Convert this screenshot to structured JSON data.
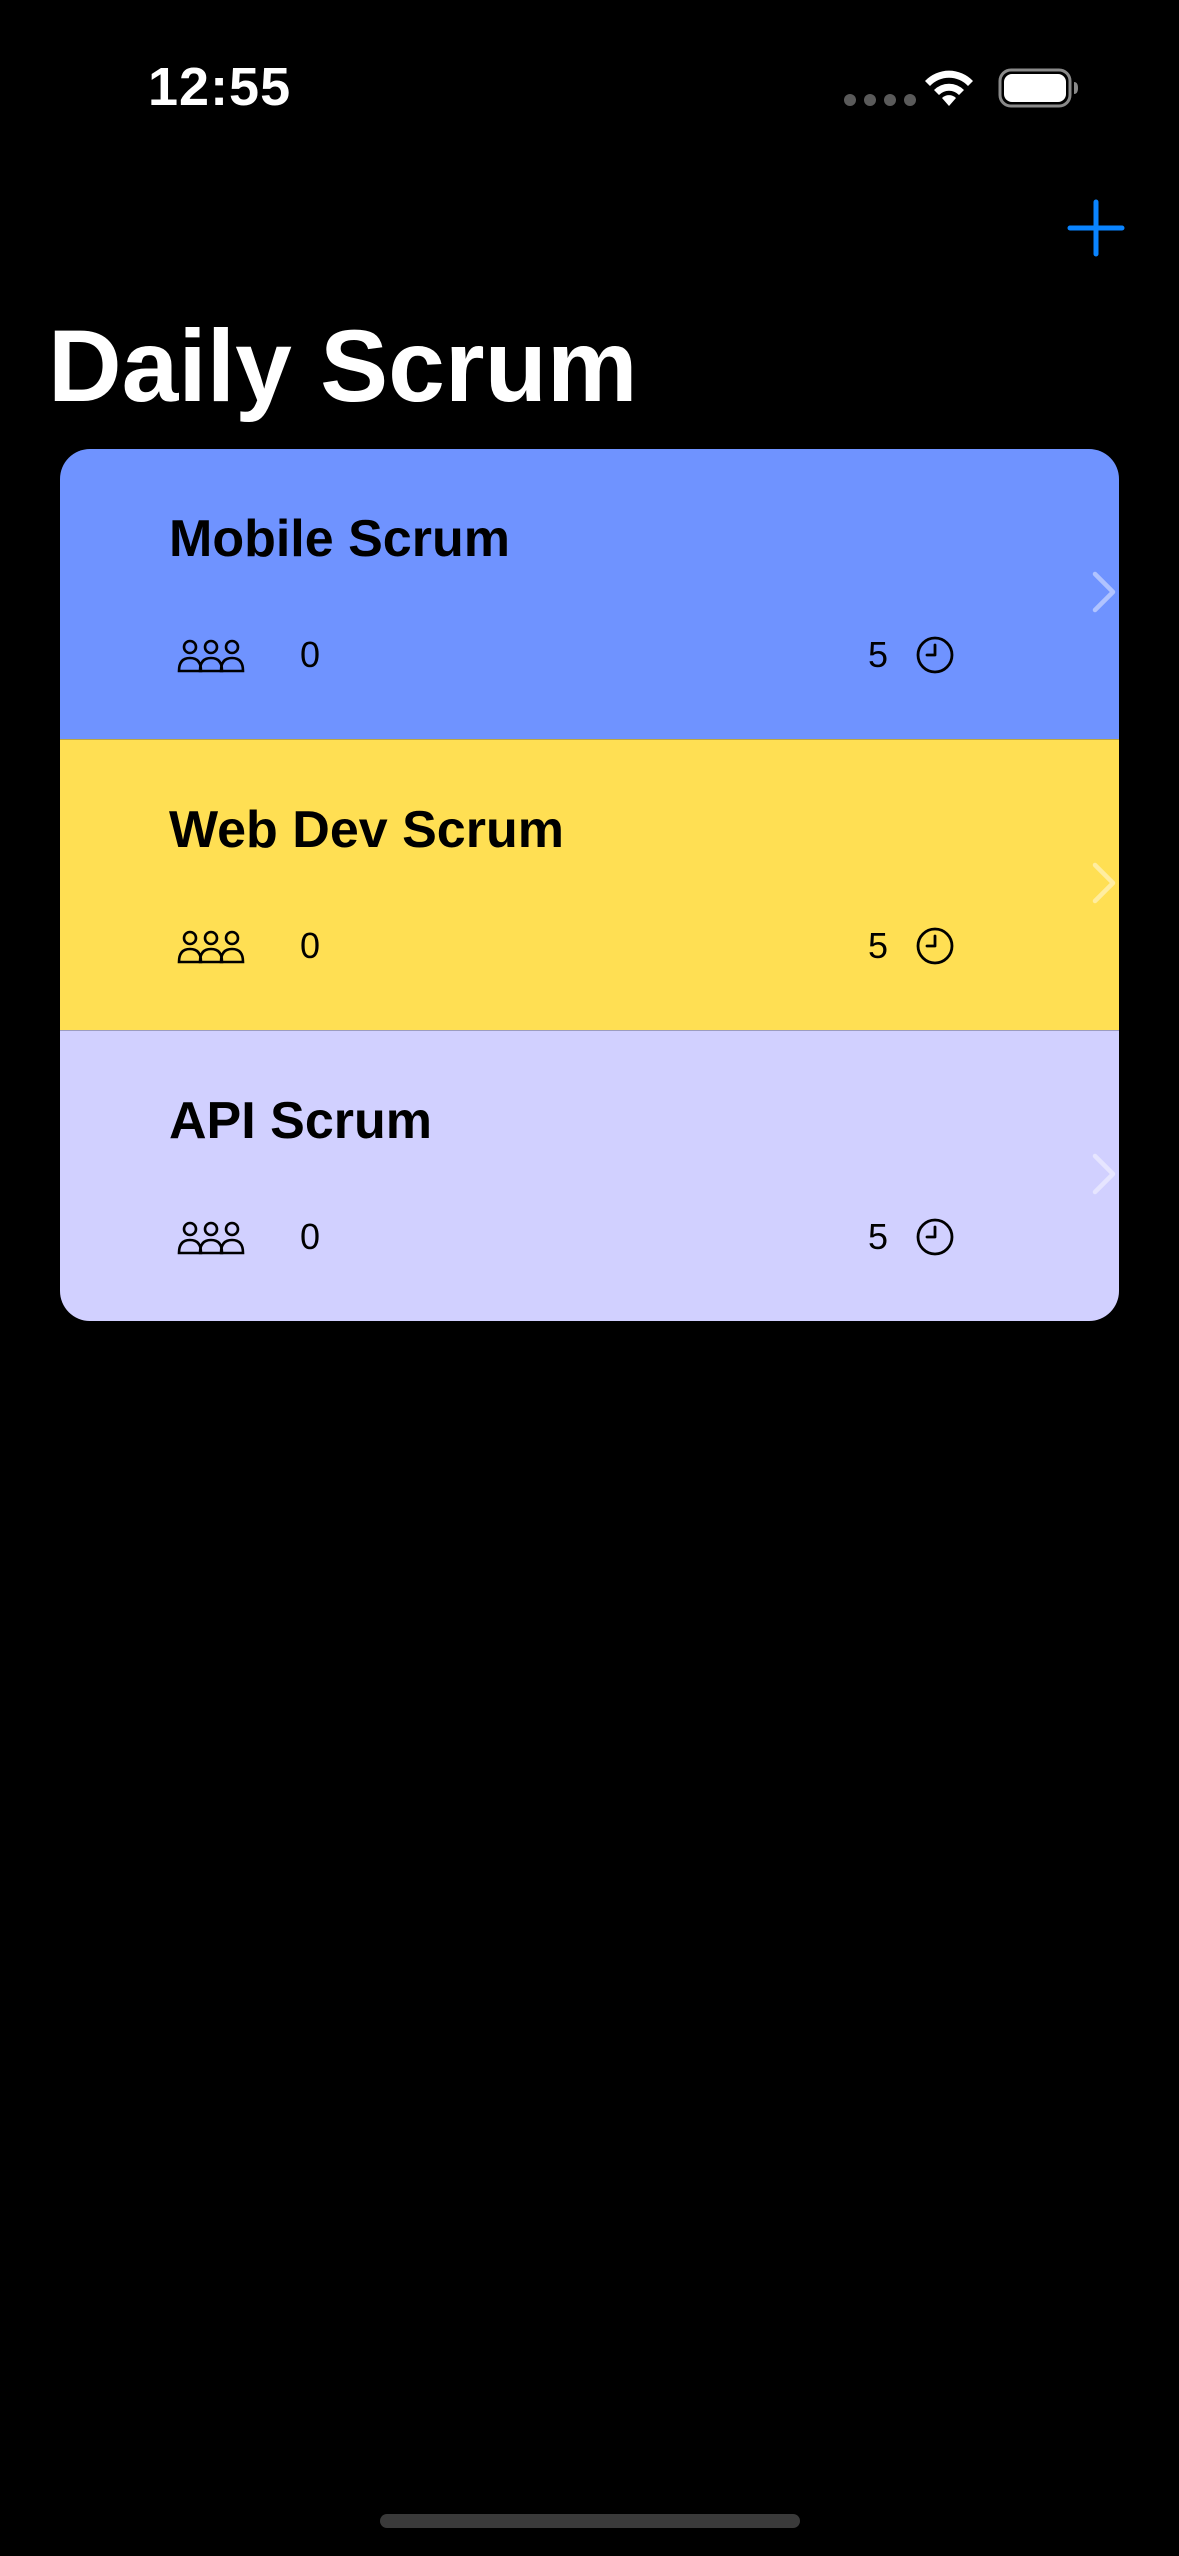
{
  "status_bar": {
    "time": "12:55",
    "icons": [
      "cellular-icon",
      "wifi-icon",
      "battery-icon"
    ]
  },
  "navigation": {
    "title": "Daily Scrum",
    "add_button_icon": "plus-icon",
    "accent_color": "#0a84ff"
  },
  "scrums": [
    {
      "title": "Mobile Scrum",
      "attendees": "0",
      "minutes": "5",
      "color": "#6f93ff",
      "people_icon": "person-3-icon",
      "clock_icon": "clock-icon"
    },
    {
      "title": "Web Dev Scrum",
      "attendees": "0",
      "minutes": "5",
      "color": "#ffdf53",
      "people_icon": "person-3-icon",
      "clock_icon": "clock-icon"
    },
    {
      "title": "API Scrum",
      "attendees": "0",
      "minutes": "5",
      "color": "#d1d0ff",
      "people_icon": "person-3-icon",
      "clock_icon": "clock-icon"
    }
  ]
}
